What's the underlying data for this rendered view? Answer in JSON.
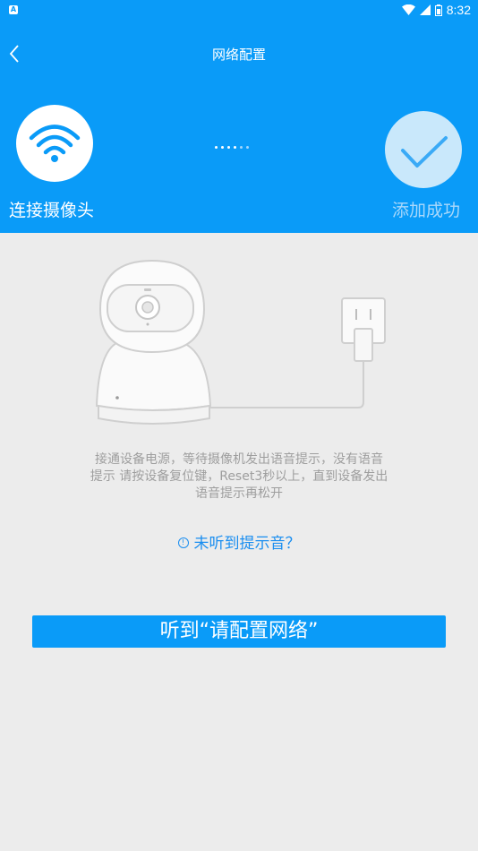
{
  "status_bar": {
    "app_badge": "A",
    "time": "8:32"
  },
  "header": {
    "title": "网络配置"
  },
  "steps": [
    {
      "label": "连接摄像头",
      "icon": "wifi-icon",
      "state": "active"
    },
    {
      "label": "添加成功",
      "icon": "checkmark-icon",
      "state": "inactive"
    }
  ],
  "instructions": {
    "line1": "接通设备电源，等待摄像机发出语音提示，没有语音",
    "line2": "提示 请按设备复位键，Reset3秒以上，直到设备发出",
    "line3": "语音提示再松开"
  },
  "help_link": {
    "label": "未听到提示音？",
    "icon": "info-icon"
  },
  "primary_button": {
    "label": "听到“请配置网络”"
  },
  "colors": {
    "accent": "#0a9bf8",
    "background": "#ececec",
    "link": "#1a8ef0"
  }
}
